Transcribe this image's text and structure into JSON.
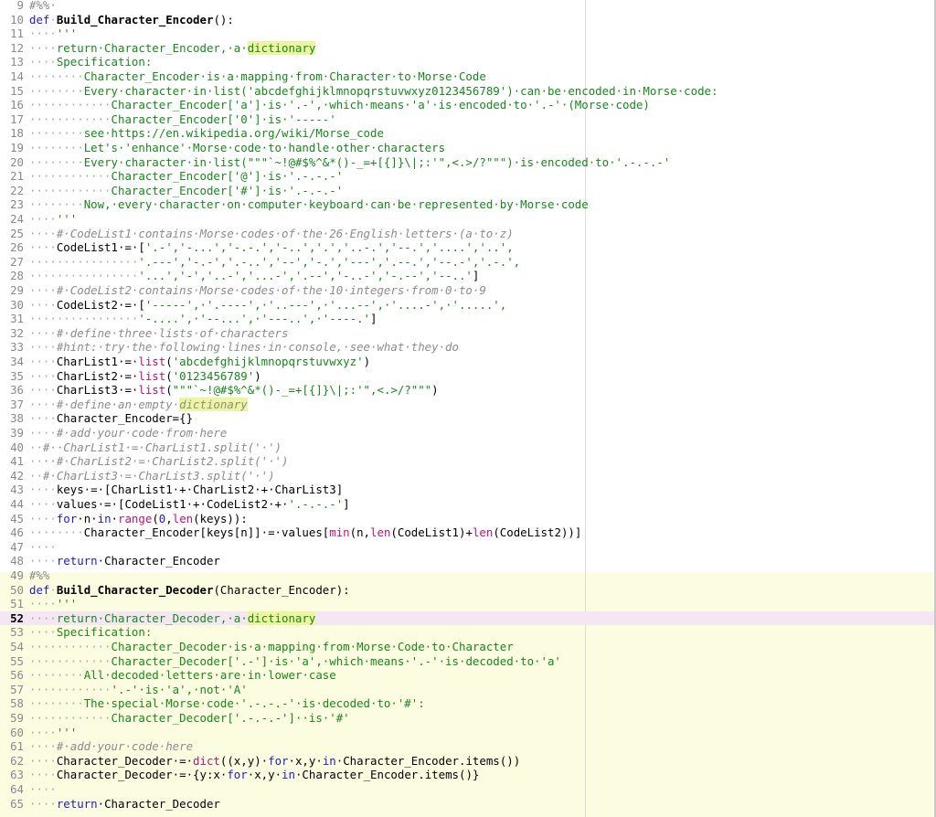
{
  "editor": {
    "current_line": 52,
    "colors": {
      "keyword": "#1b1bd2",
      "string": "#17891b",
      "comment": "#8c8c8c",
      "builtin_call": "#c2117a",
      "highlight": "#eef5a0",
      "cell_background": "#fcfce1",
      "current_line": "#f4e7f3"
    },
    "lines": [
      {
        "n": "9",
        "tokens": [
          [
            "cmt",
            "#%%·"
          ]
        ]
      },
      {
        "n": "10",
        "tokens": [
          [
            "kw",
            "def"
          ],
          [
            "ws",
            "·"
          ],
          [
            "fn",
            "Build_Character_Encoder"
          ],
          [
            "",
            "():"
          ]
        ]
      },
      {
        "n": "11",
        "tokens": [
          [
            "ws",
            "····"
          ],
          [
            "str",
            "'''"
          ]
        ]
      },
      {
        "n": "12",
        "tokens": [
          [
            "ws",
            "····"
          ],
          [
            "str",
            "return·Character_Encoder,·a·"
          ],
          [
            "hl",
            "dictionary"
          ]
        ]
      },
      {
        "n": "13",
        "tokens": [
          [
            "ws",
            "····"
          ],
          [
            "str",
            "Specification:"
          ]
        ]
      },
      {
        "n": "14",
        "tokens": [
          [
            "ws",
            "········"
          ],
          [
            "str",
            "Character_Encoder·is·a·mapping·from·Character·to·Morse·Code"
          ]
        ]
      },
      {
        "n": "15",
        "tokens": [
          [
            "ws",
            "········"
          ],
          [
            "str",
            "Every·character·in·list('abcdefghijklmnopqrstuvwxyz0123456789')·can·be·encoded·in·Morse·code:"
          ]
        ]
      },
      {
        "n": "16",
        "tokens": [
          [
            "ws",
            "············"
          ],
          [
            "str",
            "Character_Encoder['a']·is·'.-',·which·means·'a'·is·encoded·to·'.-'·(Morse·code)"
          ]
        ]
      },
      {
        "n": "17",
        "tokens": [
          [
            "ws",
            "············"
          ],
          [
            "str",
            "Character_Encoder['0']·is·'-----'"
          ]
        ]
      },
      {
        "n": "18",
        "tokens": [
          [
            "ws",
            "········"
          ],
          [
            "str",
            "see·https://en.wikipedia.org/wiki/Morse_code"
          ]
        ]
      },
      {
        "n": "19",
        "tokens": [
          [
            "ws",
            "········"
          ],
          [
            "str",
            "Let's·'enhance'·Morse·code·to·handle·other·characters"
          ]
        ]
      },
      {
        "n": "20",
        "tokens": [
          [
            "ws",
            "········"
          ],
          [
            "str",
            "Every·character·in·list(\"\"\"`~!@#$%^&*()-_=+[{]}\\|;:'\",<.>/?\"\"\")·is·encoded·to·'.-.-.-'"
          ]
        ]
      },
      {
        "n": "21",
        "tokens": [
          [
            "ws",
            "············"
          ],
          [
            "str",
            "Character_Encoder['@']·is·'.-.-.-'"
          ]
        ]
      },
      {
        "n": "22",
        "tokens": [
          [
            "ws",
            "············"
          ],
          [
            "str",
            "Character_Encoder['#']·is·'.-.-.-'"
          ]
        ]
      },
      {
        "n": "23",
        "tokens": [
          [
            "ws",
            "········"
          ],
          [
            "str",
            "Now,·every·character·on·computer·keyboard·can·be·represented·by·Morse·code"
          ]
        ]
      },
      {
        "n": "24",
        "tokens": [
          [
            "ws",
            "····"
          ],
          [
            "str",
            "'''"
          ]
        ]
      },
      {
        "n": "25",
        "tokens": [
          [
            "ws",
            "····"
          ],
          [
            "cmt",
            "#·CodeList1·contains·Morse·codes·of·the·26·English·letters·(a·to·z)"
          ]
        ]
      },
      {
        "n": "26",
        "tokens": [
          [
            "ws",
            "····"
          ],
          [
            "",
            "CodeList1·=·["
          ],
          [
            "str",
            "'.-','-...','-.-.','-..','.','..-.','--.','....','..',"
          ]
        ]
      },
      {
        "n": "27",
        "tokens": [
          [
            "ws",
            "················"
          ],
          [
            "str",
            "'.---','-.-','.-..','--','-.','---','.--.','--.-','.-.',"
          ]
        ]
      },
      {
        "n": "28",
        "tokens": [
          [
            "ws",
            "················"
          ],
          [
            "str",
            "'...','-','..-','...-','.--','-..-','-.--','--..'"
          ],
          [
            "",
            "]"
          ]
        ]
      },
      {
        "n": "29",
        "tokens": [
          [
            "ws",
            "····"
          ],
          [
            "cmt",
            "#·CodeList2·contains·Morse·codes·of·the·10·integers·from·0·to·9"
          ]
        ]
      },
      {
        "n": "30",
        "tokens": [
          [
            "ws",
            "····"
          ],
          [
            "",
            "CodeList2·=·["
          ],
          [
            "str",
            "'-----',·'.----',·'..---',·'...--',·'....-',·'.....',"
          ]
        ]
      },
      {
        "n": "31",
        "tokens": [
          [
            "ws",
            "················"
          ],
          [
            "str",
            "'-....',·'--...',·'---..',·'----.'"
          ],
          [
            "",
            "]"
          ]
        ]
      },
      {
        "n": "32",
        "tokens": [
          [
            "ws",
            "····"
          ],
          [
            "cmt",
            "#·define·three·lists·of·characters"
          ]
        ]
      },
      {
        "n": "33",
        "tokens": [
          [
            "ws",
            "····"
          ],
          [
            "cmt",
            "#hint:·try·the·following·lines·in·console,·see·what·they·do"
          ]
        ]
      },
      {
        "n": "34",
        "tokens": [
          [
            "ws",
            "····"
          ],
          [
            "",
            "CharList1·=·"
          ],
          [
            "call",
            "list"
          ],
          [
            "",
            "("
          ],
          [
            "str",
            "'abcdefghijklmnopqrstuvwxyz'"
          ],
          [
            "",
            ")"
          ]
        ]
      },
      {
        "n": "35",
        "tokens": [
          [
            "ws",
            "····"
          ],
          [
            "",
            "CharList2·=·"
          ],
          [
            "call",
            "list"
          ],
          [
            "",
            "("
          ],
          [
            "str",
            "'0123456789'"
          ],
          [
            "",
            ")"
          ]
        ]
      },
      {
        "n": "36",
        "tokens": [
          [
            "ws",
            "····"
          ],
          [
            "",
            "CharList3·=·"
          ],
          [
            "call",
            "list"
          ],
          [
            "",
            "("
          ],
          [
            "str",
            "\"\"\"`~!@#$%^&*()-_=+[{]}\\|;:'\",<.>/?\"\"\""
          ],
          [
            "",
            ")"
          ]
        ]
      },
      {
        "n": "37",
        "tokens": [
          [
            "ws",
            "····"
          ],
          [
            "cmt",
            "#·define·an·empty·"
          ],
          [
            "hlcmt",
            "dictionary"
          ]
        ]
      },
      {
        "n": "38",
        "tokens": [
          [
            "ws",
            "····"
          ],
          [
            "",
            "Character_Encoder={}"
          ]
        ]
      },
      {
        "n": "39",
        "tokens": [
          [
            "ws",
            "····"
          ],
          [
            "cmt",
            "#·add·your·code·from·here"
          ]
        ]
      },
      {
        "n": "40",
        "tokens": [
          [
            "ws",
            "··"
          ],
          [
            "cmt",
            "#··CharList1·=·CharList1.split('·')"
          ]
        ]
      },
      {
        "n": "41",
        "tokens": [
          [
            "ws",
            "··"
          ],
          [
            "cmt",
            "··#·CharList2·=·CharList2.split('·')"
          ]
        ]
      },
      {
        "n": "42",
        "tokens": [
          [
            "ws",
            "··"
          ],
          [
            "cmt",
            "#·CharList3·=·CharList3.split('·')"
          ]
        ]
      },
      {
        "n": "43",
        "tokens": [
          [
            "ws",
            "····"
          ],
          [
            "",
            "keys·=·[CharList1·+·CharList2·+·CharList3]"
          ]
        ]
      },
      {
        "n": "44",
        "tokens": [
          [
            "ws",
            "····"
          ],
          [
            "",
            "values·=·[CodeList1·+·CodeList2·+·"
          ],
          [
            "str",
            "'.-.-.-'"
          ],
          [
            "",
            "]"
          ]
        ]
      },
      {
        "n": "45",
        "tokens": [
          [
            "ws",
            "····"
          ],
          [
            "kw",
            "for"
          ],
          [
            "",
            "·n·"
          ],
          [
            "kw",
            "in"
          ],
          [
            "",
            "·"
          ],
          [
            "call",
            "range"
          ],
          [
            "",
            "("
          ],
          [
            "num",
            "0"
          ],
          [
            "",
            ","
          ],
          [
            "call",
            "len"
          ],
          [
            "",
            "(keys)):"
          ]
        ]
      },
      {
        "n": "46",
        "tokens": [
          [
            "ws",
            "········"
          ],
          [
            "",
            "Character_Encoder[keys[n]]·=·values["
          ],
          [
            "call",
            "min"
          ],
          [
            "",
            "(n,"
          ],
          [
            "call",
            "len"
          ],
          [
            "",
            "(CodeList1)+"
          ],
          [
            "call",
            "len"
          ],
          [
            "",
            "(CodeList2))]"
          ]
        ]
      },
      {
        "n": "47",
        "tokens": [
          [
            "ws",
            "····"
          ]
        ]
      },
      {
        "n": "48",
        "tokens": [
          [
            "ws",
            "····"
          ],
          [
            "kw",
            "return"
          ],
          [
            "",
            "·Character_Encoder"
          ]
        ]
      },
      {
        "n": "49",
        "tokens": [
          [
            "cmt",
            "#%%"
          ]
        ]
      },
      {
        "n": "50",
        "tokens": [
          [
            "kw",
            "def"
          ],
          [
            "ws",
            "·"
          ],
          [
            "fn",
            "Build_Character_Decoder"
          ],
          [
            "",
            "(Character_Encoder):"
          ]
        ]
      },
      {
        "n": "51",
        "tokens": [
          [
            "ws",
            "····"
          ],
          [
            "str",
            "'''"
          ]
        ]
      },
      {
        "n": "52",
        "tokens": [
          [
            "ws",
            "····"
          ],
          [
            "str",
            "return·Character_Decoder,·a·"
          ],
          [
            "hl",
            "dictionary"
          ]
        ]
      },
      {
        "n": "53",
        "tokens": [
          [
            "ws",
            "····"
          ],
          [
            "str",
            "Specification:"
          ]
        ]
      },
      {
        "n": "54",
        "tokens": [
          [
            "ws",
            "············"
          ],
          [
            "str",
            "Character_Decoder·is·a·mapping·from·Morse·Code·to·Character"
          ]
        ]
      },
      {
        "n": "55",
        "tokens": [
          [
            "ws",
            "············"
          ],
          [
            "str",
            "Character_Decoder['.-']·is·'a',·which·means·'.-'·is·decoded·to·'a'"
          ]
        ]
      },
      {
        "n": "56",
        "tokens": [
          [
            "ws",
            "········"
          ],
          [
            "str",
            "All·decoded·letters·are·in·lower·case"
          ]
        ]
      },
      {
        "n": "57",
        "tokens": [
          [
            "ws",
            "············"
          ],
          [
            "str",
            "'.-'·is·'a',·not·'A'"
          ]
        ]
      },
      {
        "n": "58",
        "tokens": [
          [
            "ws",
            "········"
          ],
          [
            "str",
            "The·special·Morse·code·'.-.-.-'·is·decoded·to·'#':"
          ]
        ]
      },
      {
        "n": "59",
        "tokens": [
          [
            "ws",
            "············"
          ],
          [
            "str",
            "Character_Decoder['.-.-.-']··is·'#'"
          ]
        ]
      },
      {
        "n": "60",
        "tokens": [
          [
            "ws",
            "····"
          ],
          [
            "str",
            "'''"
          ]
        ]
      },
      {
        "n": "61",
        "tokens": [
          [
            "ws",
            "····"
          ],
          [
            "cmt",
            "#·add·your·code·here"
          ]
        ]
      },
      {
        "n": "62",
        "tokens": [
          [
            "ws",
            "····"
          ],
          [
            "",
            "Character_Decoder·=·"
          ],
          [
            "call",
            "dict"
          ],
          [
            "",
            "((x,y)·"
          ],
          [
            "kw",
            "for"
          ],
          [
            "",
            "·x,y·"
          ],
          [
            "kw",
            "in"
          ],
          [
            "",
            "·Character_Encoder.items())"
          ]
        ]
      },
      {
        "n": "63",
        "tokens": [
          [
            "ws",
            "····"
          ],
          [
            "",
            "Character_Decoder·=·{y:x·"
          ],
          [
            "kw",
            "for"
          ],
          [
            "",
            "·x,y·"
          ],
          [
            "kw",
            "in"
          ],
          [
            "",
            "·Character_Encoder.items()}"
          ]
        ]
      },
      {
        "n": "64",
        "tokens": [
          [
            "ws",
            "····"
          ]
        ]
      },
      {
        "n": "65",
        "tokens": [
          [
            "ws",
            "····"
          ],
          [
            "kw",
            "return"
          ],
          [
            "",
            "·Character_Decoder"
          ]
        ]
      }
    ]
  }
}
